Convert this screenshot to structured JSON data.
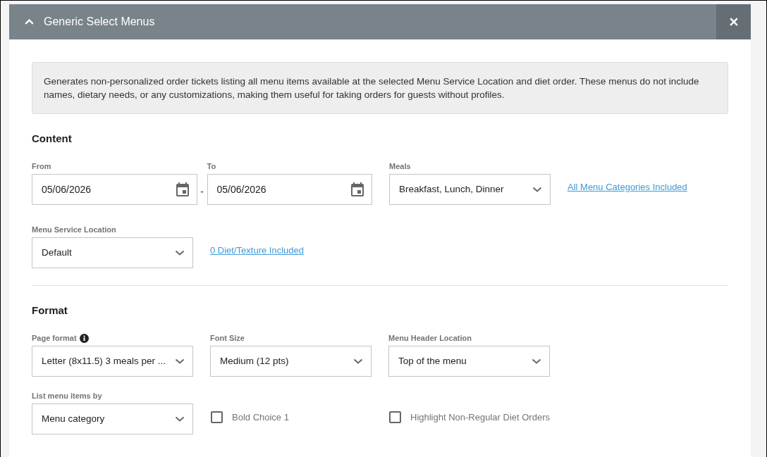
{
  "dialog": {
    "title": "Generic Select Menus",
    "expanded": true,
    "description": "Generates non-personalized order tickets listing all menu items available at the selected Menu Service Location and diet order. These menus do not include names, dietary needs, or any customizations, making them useful for taking orders for guests without profiles.",
    "sections": [
      {
        "title": "Content",
        "rows": [
          {
            "fields": [
              {
                "kind": "date_range",
                "from": {
                  "label": "From",
                  "value": "05/06/2026"
                },
                "separator": "-",
                "to": {
                  "label": "To",
                  "value": "05/06/2026"
                }
              },
              {
                "kind": "select",
                "label": "Meals",
                "info": false,
                "value": "Breakfast, Lunch, Dinner"
              },
              {
                "kind": "link",
                "text": "All Menu Categories Included"
              }
            ]
          },
          {
            "fields": [
              {
                "kind": "select",
                "label": "Menu Service Location",
                "info": false,
                "value": "Default"
              },
              {
                "kind": "link",
                "text": "0 Diet/Texture Included"
              }
            ]
          }
        ]
      },
      {
        "title": "Format",
        "rows": [
          {
            "fields": [
              {
                "kind": "select",
                "label": "Page format",
                "info": true,
                "value": "Letter (8x11.5) 3 meals per ..."
              },
              {
                "kind": "select",
                "label": "Font Size",
                "info": false,
                "value": "Medium (12 pts)"
              },
              {
                "kind": "select",
                "label": "Menu Header Location",
                "info": false,
                "value": "Top of the menu"
              }
            ]
          },
          {
            "fields": [
              {
                "kind": "select",
                "label": "List menu items by",
                "info": false,
                "value": "Menu category"
              },
              {
                "kind": "checkbox",
                "label": "Bold Choice 1",
                "checked": false
              },
              {
                "kind": "checkbox",
                "label": "Highlight Non-Regular Diet Orders",
                "checked": false
              }
            ]
          }
        ]
      }
    ]
  }
}
